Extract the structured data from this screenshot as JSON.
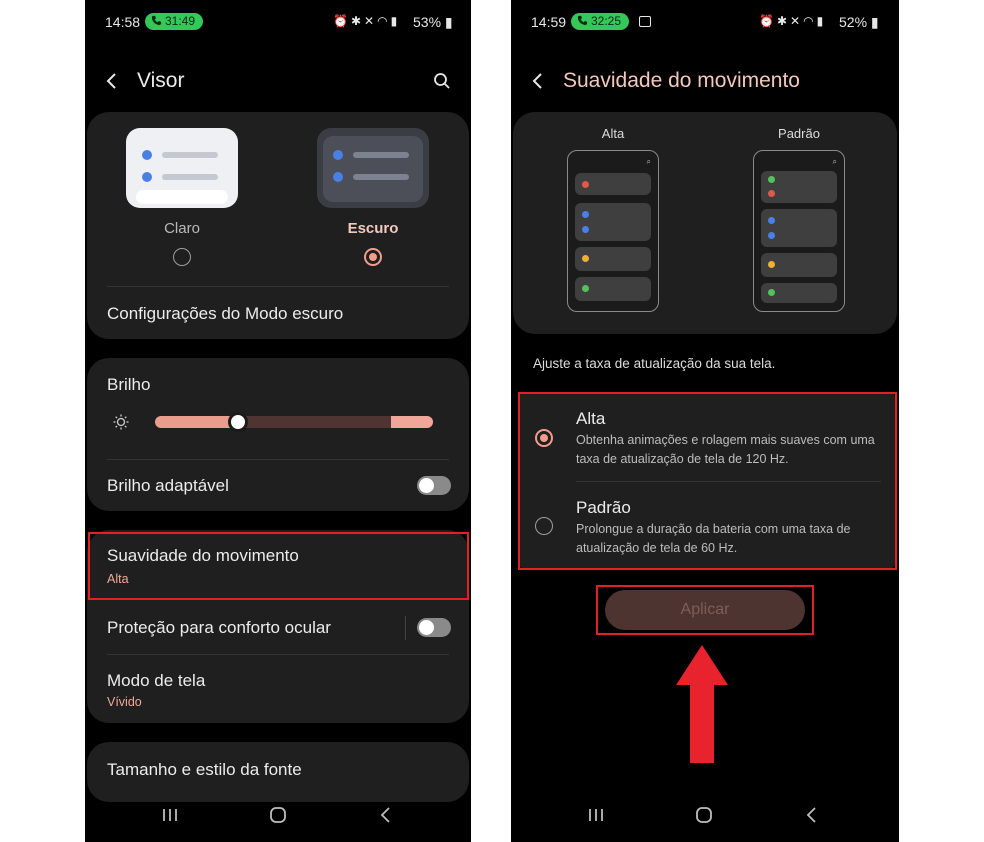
{
  "left": {
    "status": {
      "time": "14:58",
      "call": "31:49",
      "battery": "53%"
    },
    "header": {
      "title": "Visor"
    },
    "theme": {
      "light_label": "Claro",
      "dark_label": "Escuro",
      "selected": "dark"
    },
    "dark_mode_settings": "Configurações do Modo escuro",
    "brightness": {
      "title": "Brilho",
      "level": 0.3
    },
    "adaptive_brightness": {
      "title": "Brilho adaptável",
      "on": false
    },
    "motion_smoothness": {
      "title": "Suavidade do movimento",
      "value": "Alta"
    },
    "eye_comfort": {
      "title": "Proteção para conforto ocular",
      "on": false
    },
    "screen_mode": {
      "title": "Modo de tela",
      "value": "Vívido"
    },
    "font": {
      "title": "Tamanho e estilo da fonte"
    }
  },
  "right": {
    "status": {
      "time": "14:59",
      "call": "32:25",
      "battery": "52%"
    },
    "header": {
      "title": "Suavidade do movimento"
    },
    "preview": {
      "high_label": "Alta",
      "standard_label": "Padrão"
    },
    "description": "Ajuste a taxa de atualização da sua tela.",
    "options": [
      {
        "title": "Alta",
        "desc": "Obtenha animações e rolagem mais suaves com uma taxa de atualização de tela de 120 Hz.",
        "selected": true
      },
      {
        "title": "Padrão",
        "desc": "Prolongue a duração da bateria com uma taxa de atualização de tela de 60 Hz.",
        "selected": false
      }
    ],
    "apply_label": "Aplicar"
  },
  "colors": {
    "accent": "#f19d8c",
    "highlight": "#e02222",
    "card": "#1f1f1f",
    "call": "#34c759"
  },
  "icons": [
    "phone-icon",
    "alarm-icon",
    "bluetooth-icon",
    "mute-icon",
    "wifi-icon",
    "signal-icon",
    "battery-icon",
    "gallery-icon",
    "back-icon",
    "search-icon",
    "sun-icon",
    "recent-apps-icon",
    "home-icon",
    "nav-back-icon",
    "up-arrow-icon"
  ]
}
